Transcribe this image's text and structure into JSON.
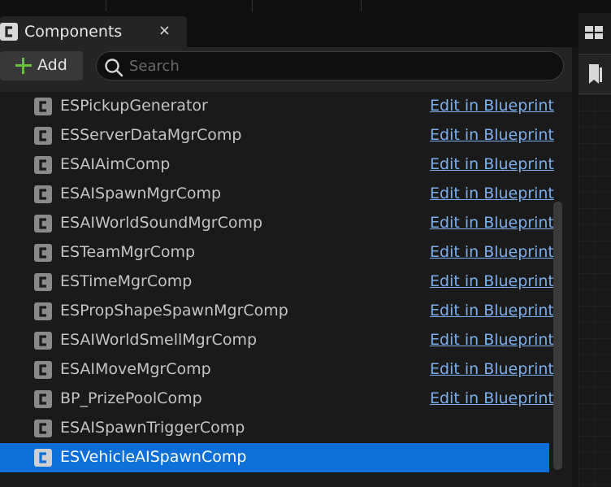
{
  "tab": {
    "title": "Components",
    "close": "×"
  },
  "toolbar": {
    "add_label": "Add",
    "search_placeholder": "Search"
  },
  "link_label": "Edit in Blueprint",
  "components": [
    {
      "name": "ESPickupGenerator",
      "link": "Edit in Blueprint"
    },
    {
      "name": "ESServerDataMgrComp",
      "link": "Edit in Blueprint"
    },
    {
      "name": "ESAIAimComp",
      "link": "Edit in Blueprint"
    },
    {
      "name": "ESAISpawnMgrComp",
      "link": "Edit in Blueprint"
    },
    {
      "name": "ESAIWorldSoundMgrComp",
      "link": "Edit in Blueprint"
    },
    {
      "name": "ESTeamMgrComp",
      "link": "Edit in Blueprint"
    },
    {
      "name": "ESTimeMgrComp",
      "link": "Edit in Blueprint"
    },
    {
      "name": "ESPropShapeSpawnMgrComp",
      "link": "Edit in Blueprint"
    },
    {
      "name": "ESAIWorldSmellMgrComp",
      "link": "Edit in Blueprint"
    },
    {
      "name": "ESAIMoveMgrComp",
      "link": "Edit in Blueprint"
    },
    {
      "name": "BP_PrizePoolComp",
      "link": "Edit in Blueprint"
    },
    {
      "name": "ESAISpawnTriggerComp",
      "link": ""
    },
    {
      "name": "ESVehicleAISpawnComp",
      "link": "",
      "selected": true
    }
  ],
  "icons": {
    "component": "component-class-icon",
    "search": "search-icon",
    "plus": "plus-icon",
    "layout": "layout-grid-icon",
    "bookmark": "bookmark-icon"
  },
  "colors": {
    "selection": "#0d70d8",
    "link": "#7ab0ef",
    "add_plus": "#6abf3a"
  }
}
